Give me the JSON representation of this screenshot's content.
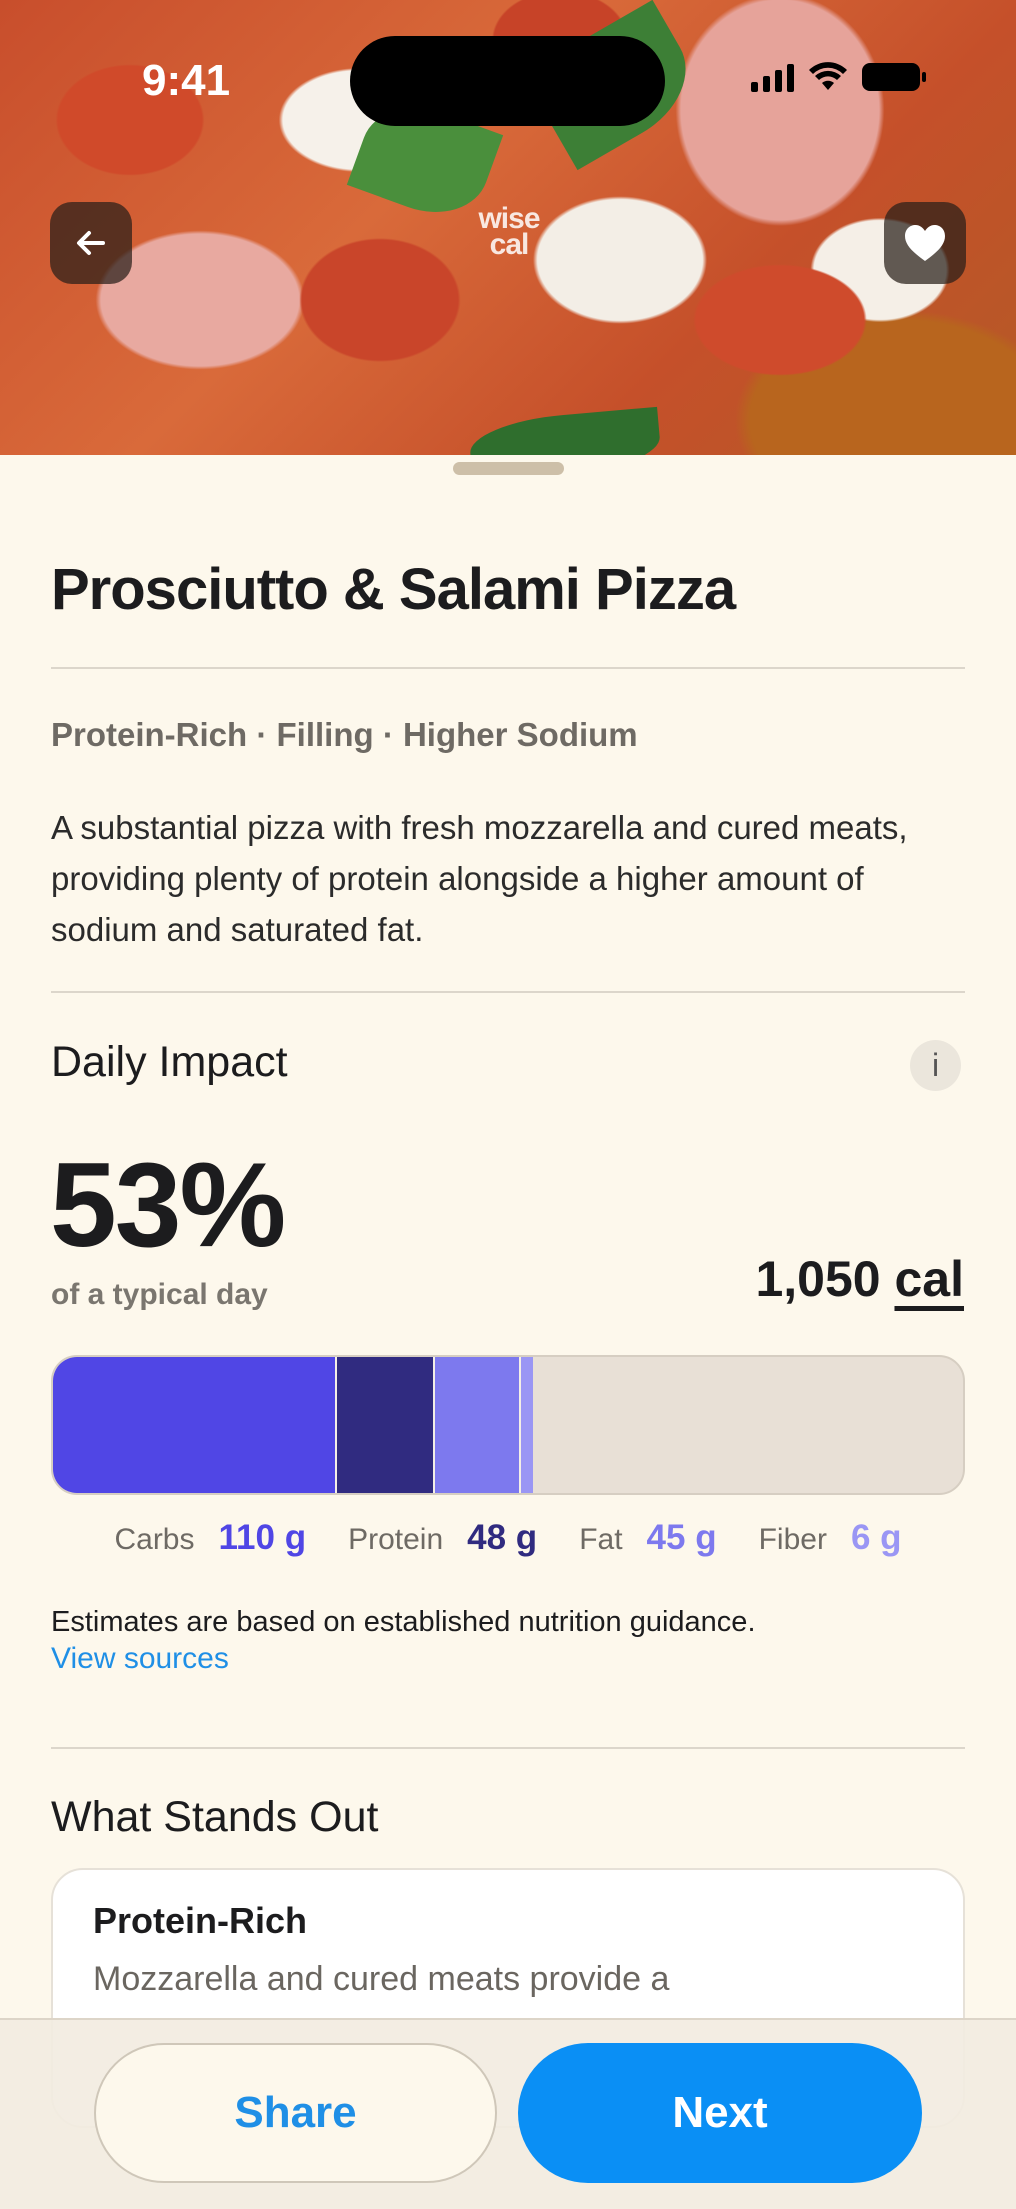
{
  "status_bar": {
    "time": "9:41"
  },
  "hero": {
    "logo_text": "wise cal",
    "back_icon": "arrow-left-icon",
    "favorite_icon": "heart-icon"
  },
  "food": {
    "title": "Prosciutto & Salami Pizza",
    "tags": "Protein-Rich · Filling · Higher Sodium",
    "description": "A substantial pizza with fresh mozzarella and cured meats, providing plenty of protein alongside a higher amount of sodium and saturated fat."
  },
  "daily_impact": {
    "heading": "Daily Impact",
    "info_label": "i",
    "percent": "53%",
    "percent_caption": "of a typical day",
    "calories_value": "1,050",
    "calories_unit": "cal",
    "bar_fraction_filled": 0.53,
    "macros": [
      {
        "label": "Carbs",
        "value": "110 g",
        "color": "#5046e5",
        "share": 0.312
      },
      {
        "label": "Protein",
        "value": "48 g",
        "color": "#302b80",
        "share": 0.108
      },
      {
        "label": "Fat",
        "value": "45 g",
        "color": "#7d79ee",
        "share": 0.094
      },
      {
        "label": "Fiber",
        "value": "6 g",
        "color": "#9a96f4",
        "share": 0.013
      }
    ],
    "track_color": "#e8e0d6",
    "note": "Estimates are based on established nutrition guidance.",
    "sources_link": "View sources"
  },
  "stands_out": {
    "heading": "What Stands Out",
    "cards": [
      {
        "title": "Protein-Rich",
        "text": "Mozzarella and cured meats provide a"
      }
    ]
  },
  "actions": {
    "share_label": "Share",
    "next_label": "Next"
  },
  "colors": {
    "accent": "#0a8ff5",
    "link": "#1f8fe6",
    "background": "#fdf8ec"
  }
}
